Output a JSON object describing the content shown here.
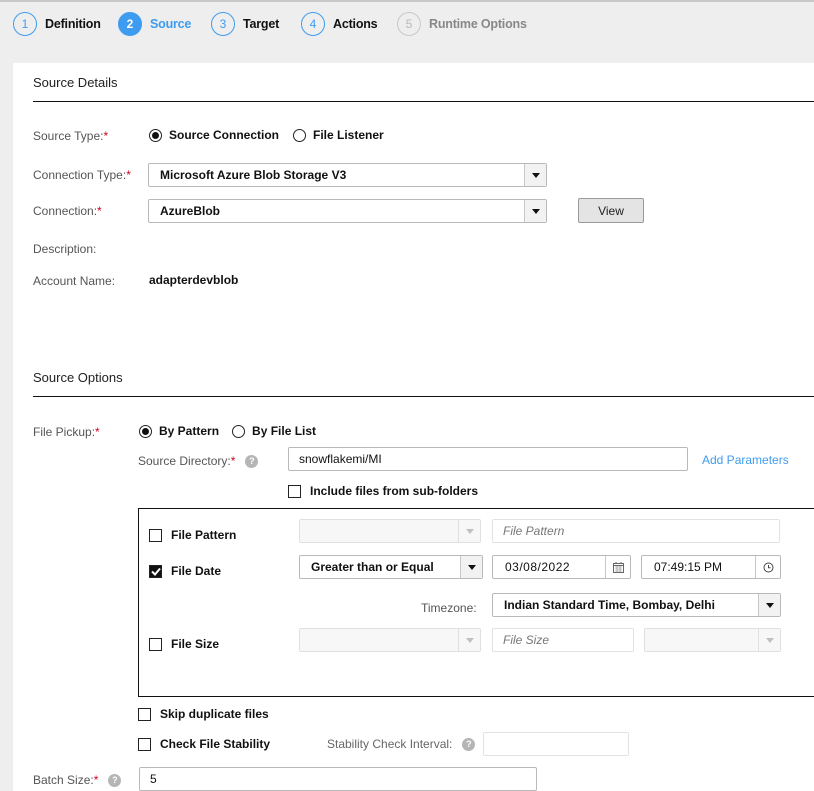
{
  "wizard": {
    "steps": [
      {
        "number": "1",
        "label": "Definition",
        "state": "done"
      },
      {
        "number": "2",
        "label": "Source",
        "state": "active"
      },
      {
        "number": "3",
        "label": "Target",
        "state": "done"
      },
      {
        "number": "4",
        "label": "Actions",
        "state": "done"
      },
      {
        "number": "5",
        "label": "Runtime Options",
        "state": "disabled"
      }
    ]
  },
  "source_details": {
    "title": "Source Details",
    "source_type": {
      "label": "Source Type:",
      "required": "*",
      "options": [
        {
          "label": "Source Connection",
          "selected": true
        },
        {
          "label": "File Listener",
          "selected": false
        }
      ]
    },
    "connection_type": {
      "label": "Connection Type:",
      "required": "*",
      "value": "Microsoft Azure Blob Storage V3"
    },
    "connection": {
      "label": "Connection:",
      "required": "*",
      "value": "AzureBlob",
      "view_button": "View"
    },
    "description": {
      "label": "Description:",
      "value": ""
    },
    "account_name": {
      "label": "Account Name:",
      "value": "adapterdevblob"
    }
  },
  "source_options": {
    "title": "Source Options",
    "file_pickup": {
      "label": "File Pickup:",
      "required": "*",
      "options": [
        {
          "label": "By Pattern",
          "selected": true
        },
        {
          "label": "By File List",
          "selected": false
        }
      ]
    },
    "source_directory": {
      "label": "Source Directory:",
      "required": "*",
      "value": "snowflakemi/MI",
      "help": "?"
    },
    "add_parameters": "Add Parameters",
    "include_subfolders": {
      "label": "Include files from sub-folders",
      "checked": false
    },
    "filters": {
      "file_pattern": {
        "label": "File Pattern",
        "checked": false,
        "operator": "",
        "placeholder": "File Pattern"
      },
      "file_date": {
        "label": "File Date",
        "checked": true,
        "operator": "Greater than or Equal",
        "date": "03/08/2022",
        "time": "07:49:15 PM",
        "timezone_label": "Timezone:",
        "timezone": "Indian Standard Time, Bombay, Delhi"
      },
      "file_size": {
        "label": "File Size",
        "checked": false,
        "operator": "",
        "placeholder": "File Size",
        "unit": ""
      }
    },
    "skip_duplicates": {
      "label": "Skip duplicate files",
      "checked": false
    },
    "check_stability": {
      "label": "Check File Stability",
      "checked": false
    },
    "stability_interval": {
      "label": "Stability Check Interval:",
      "value": "",
      "help": "?"
    },
    "batch_size": {
      "label": "Batch Size:",
      "required": "*",
      "value": "5",
      "help": "?"
    }
  },
  "colors": {
    "accent": "#3d9cf0",
    "required": "#d0021b"
  }
}
